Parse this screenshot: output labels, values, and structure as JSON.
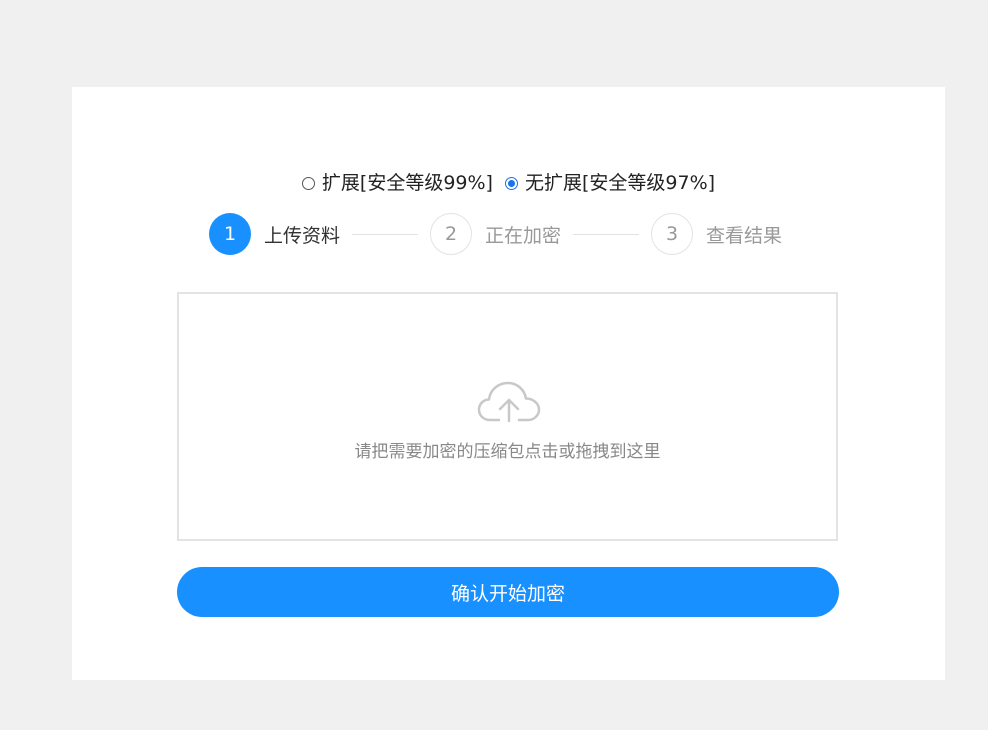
{
  "mode_options": [
    {
      "label": "扩展[安全等级99%]",
      "selected": false
    },
    {
      "label": "无扩展[安全等级97%]",
      "selected": true
    }
  ],
  "steps": [
    {
      "number": "1",
      "label": "上传资料",
      "active": true
    },
    {
      "number": "2",
      "label": "正在加密",
      "active": false
    },
    {
      "number": "3",
      "label": "查看结果",
      "active": false
    }
  ],
  "dropzone": {
    "icon": "cloud-upload-icon",
    "text": "请把需要加密的压缩包点击或拖拽到这里"
  },
  "confirm_button": {
    "label": "确认开始加密"
  },
  "colors": {
    "accent": "#1890ff",
    "radio": "#1a73e8",
    "background": "#f0f0f0"
  }
}
